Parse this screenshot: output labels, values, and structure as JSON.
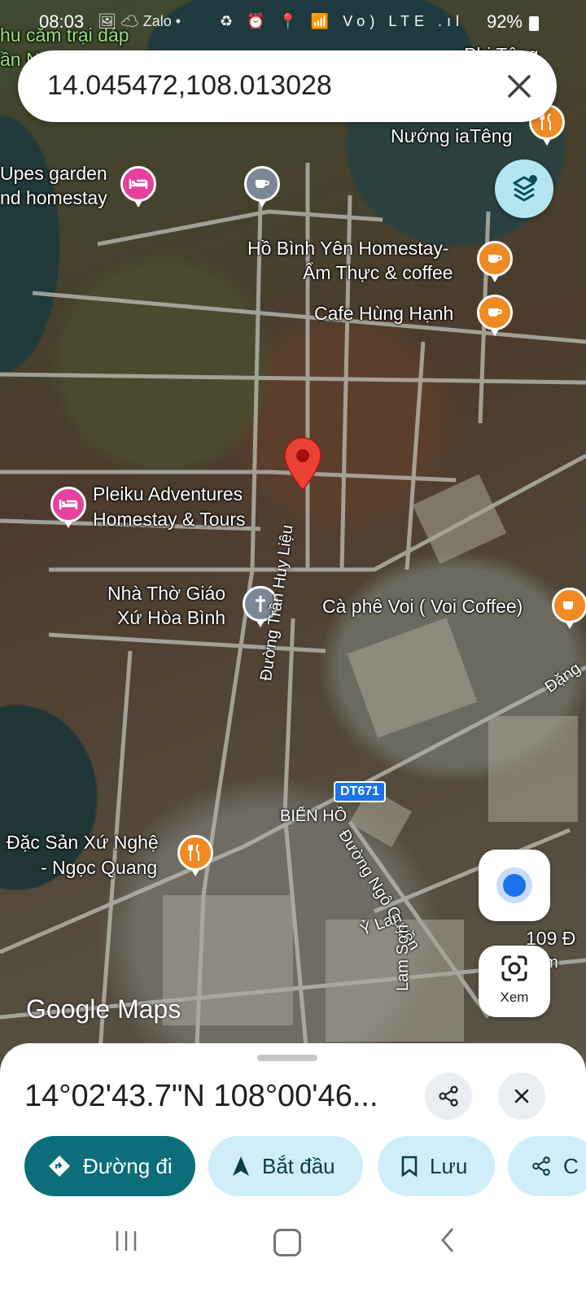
{
  "status_bar": {
    "time": "08:03",
    "battery": "92%",
    "left_icons": "🖼 ☁ Zalo •",
    "right_icons": "♻ ⏰ 📍 📶 Vo) LTE .ıl"
  },
  "search": {
    "value": "14.045472,108.013028"
  },
  "pois": [
    {
      "label": "hu cắm trại dáp",
      "kind": "text"
    },
    {
      "label": "ần N",
      "kind": "text"
    },
    {
      "label": "Nướng iaTêng",
      "kind": "restaurant"
    },
    {
      "label": "Upes garden",
      "kind": "hotel"
    },
    {
      "label": "nd homestay",
      "kind": "hotel"
    },
    {
      "label": "Hồ Bình Yên Homestay-",
      "kind": "cafe"
    },
    {
      "label": "Ẩm Thực & coffee",
      "kind": "cafe"
    },
    {
      "label": "Cafe Hùng Hạnh",
      "kind": "cafe"
    },
    {
      "label": "Pleiku Adventures",
      "kind": "hotel"
    },
    {
      "label": "Homestay & Tours",
      "kind": "hotel"
    },
    {
      "label": "Nhà Thờ Giáo",
      "kind": "church"
    },
    {
      "label": "Xứ Hòa Bình",
      "kind": "church"
    },
    {
      "label": "Cà phê Voi ( Voi Coffee)",
      "kind": "cafe"
    },
    {
      "label": "Đặc Sản Xứ Nghệ",
      "kind": "restaurant"
    },
    {
      "label": "- Ngọc Quang",
      "kind": "restaurant"
    },
    {
      "label": "109 Đ",
      "kind": "place"
    },
    {
      "label": "Phi Têng",
      "kind": "place"
    }
  ],
  "roads": {
    "tran_huy_lieu": "Đường Trần Huy Liệu",
    "ngo_quyen": "Đường Ngô Quyền",
    "bien_ho": "BIỂN HỒ",
    "y_lan": "Ỷ Lan",
    "lam_son": "Lam Sơn",
    "dang": "Đặng",
    "dt671": "DT671",
    "xem_partial": "xem"
  },
  "logo": "Google Maps",
  "xem_label": "Xem",
  "sheet": {
    "coordinates": "14°02'43.7\"N 108°00'46...",
    "chips": {
      "directions": "Đường đi",
      "start": "Bắt đầu",
      "save": "Lưu",
      "share": "C"
    }
  },
  "colors": {
    "primary_chip": "#0b6e7a",
    "secondary_chip": "#cfeefa",
    "pin_red": "#ea4335",
    "hotel_pin": "#e5419d",
    "food_pin": "#f08a24",
    "location_blue": "#1a73e8"
  }
}
